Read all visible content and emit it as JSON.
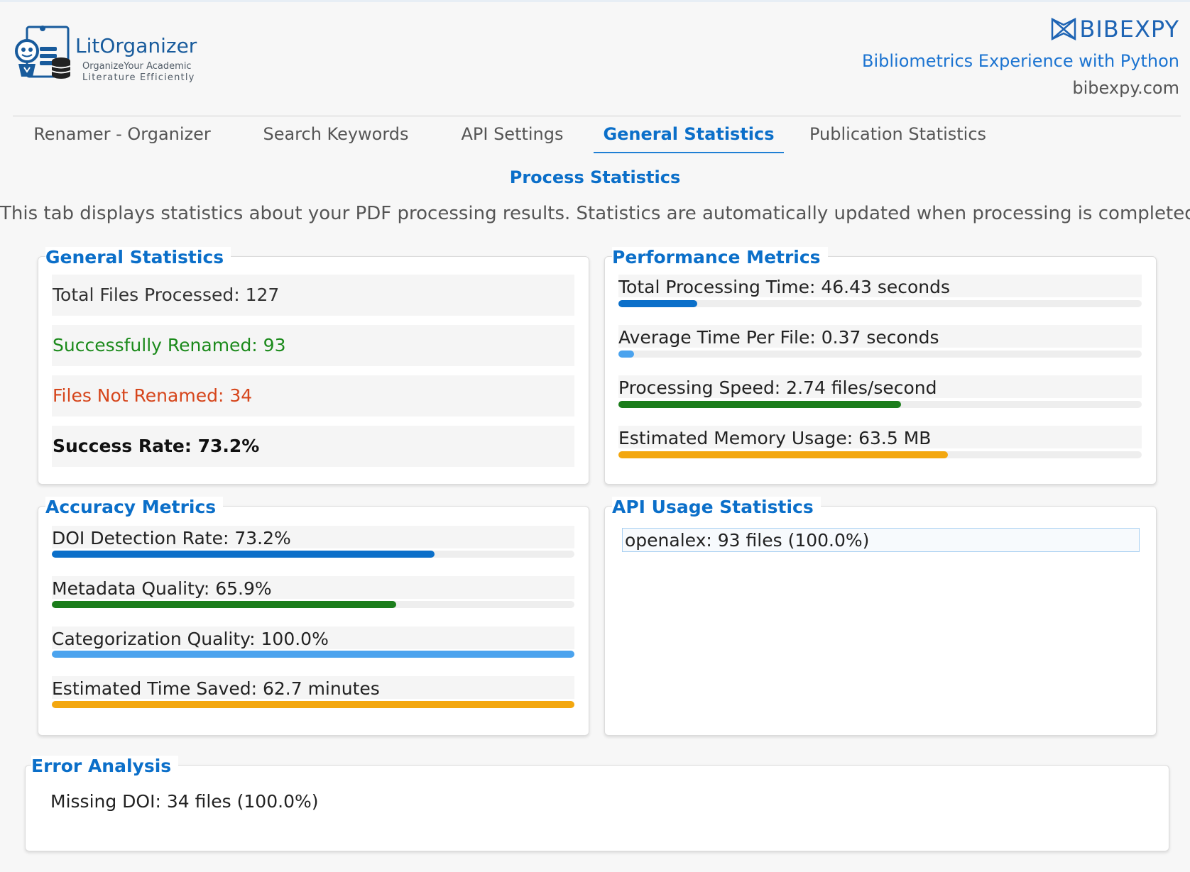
{
  "header": {
    "logo_title": "LitOrganizer",
    "logo_subtitle_1": "OrganizeYour Academic",
    "logo_subtitle_2": "Literature  Efficiently",
    "brand_name": "BIBEXPY",
    "brand_tagline": "Bibliometrics Experience with Python",
    "brand_site": "bibexpy.com"
  },
  "tabs": [
    {
      "label": "Renamer - Organizer",
      "active": false
    },
    {
      "label": "Search Keywords",
      "active": false
    },
    {
      "label": "API Settings",
      "active": false
    },
    {
      "label": "General Statistics",
      "active": true
    },
    {
      "label": "Publication Statistics",
      "active": false
    }
  ],
  "main": {
    "title": "Process Statistics",
    "description": "This tab displays statistics about your PDF processing results. Statistics are automatically updated when processing is completed."
  },
  "general_stats": {
    "title": "General Statistics",
    "rows": [
      {
        "text": "Total Files Processed: 127",
        "style": "normal"
      },
      {
        "text": "Successfully Renamed: 93",
        "style": "success"
      },
      {
        "text": "Files Not Renamed: 34",
        "style": "error"
      },
      {
        "text": "Success Rate: 73.2%",
        "style": "bold"
      }
    ]
  },
  "performance": {
    "title": "Performance Metrics",
    "metrics": [
      {
        "label": "Total Processing Time: 46.43 seconds",
        "fraction": 0.15,
        "color": "#0b6fc9"
      },
      {
        "label": "Average Time Per File: 0.37 seconds",
        "fraction": 0.03,
        "color": "#4ba3ee"
      },
      {
        "label": "Processing Speed: 2.74 files/second",
        "fraction": 0.54,
        "color": "#1b7d1b"
      },
      {
        "label": "Estimated Memory Usage: 63.5 MB",
        "fraction": 0.63,
        "color": "#f3a70f"
      }
    ]
  },
  "accuracy": {
    "title": "Accuracy Metrics",
    "metrics": [
      {
        "label": "DOI Detection Rate: 73.2%",
        "fraction": 0.732,
        "color": "#0b6fc9"
      },
      {
        "label": "Metadata Quality: 65.9%",
        "fraction": 0.659,
        "color": "#1b7d1b"
      },
      {
        "label": "Categorization Quality: 100.0%",
        "fraction": 1.0,
        "color": "#4ba3ee"
      },
      {
        "label": "Estimated Time Saved: 62.7 minutes",
        "fraction": 1.0,
        "color": "#f3a70f"
      }
    ]
  },
  "api_usage": {
    "title": "API Usage Statistics",
    "items": [
      "openalex: 93 files (100.0%)"
    ]
  },
  "errors": {
    "title": "Error Analysis",
    "items": [
      "Missing DOI: 34 files (100.0%)"
    ]
  }
}
